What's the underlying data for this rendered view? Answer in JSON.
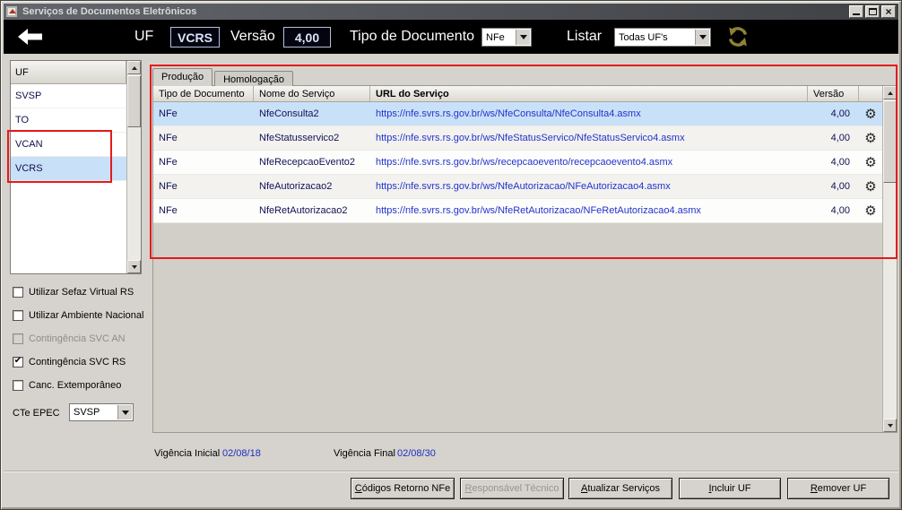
{
  "colors": {
    "annotation_red": "#e31b1b",
    "selected_row_blue": "#c9e1f8",
    "url_text_blue": "#2133cc",
    "toolbar_black": "#000000",
    "refresh_gold": "#8e8330",
    "window_gray": "#d6d3ce"
  },
  "icons": {
    "gear": "⚙",
    "check": "✔",
    "close": "×",
    "back_arrow": "left-arrow",
    "refresh": "circular-arrows",
    "dropdown": "triangle-down"
  },
  "window": {
    "title": "Serviços de Documentos Eletrônicos"
  },
  "toolbar": {
    "uf_label": "UF",
    "uf_value": "VCRS",
    "versao_label": "Versão",
    "versao_value": "4,00",
    "tipo_documento_label": "Tipo de Documento",
    "tipo_documento_value": "NFe",
    "listar_label": "Listar",
    "listar_value": "Todas UF's"
  },
  "sidebar": {
    "list": {
      "header": "UF",
      "items": [
        {
          "label": "SVSP",
          "selected": false
        },
        {
          "label": "TO",
          "selected": false
        },
        {
          "label": "VCAN",
          "selected": false
        },
        {
          "label": "VCRS",
          "selected": true
        }
      ]
    },
    "checkboxes": [
      {
        "label": "Utilizar Sefaz Virtual RS",
        "checked": false,
        "disabled": false
      },
      {
        "label": "Utilizar Ambiente Nacional",
        "checked": false,
        "disabled": false
      },
      {
        "label": "Contingência SVC AN",
        "checked": false,
        "disabled": true
      },
      {
        "label": "Contingência SVC RS",
        "checked": true,
        "disabled": false
      },
      {
        "label": "Canc. Extemporâneo",
        "checked": false,
        "disabled": false
      }
    ],
    "cte_epec": {
      "label": "CTe EPEC",
      "value": "SVSP"
    }
  },
  "main": {
    "tabs": [
      {
        "label": "Produção",
        "active": true
      },
      {
        "label": "Homologação",
        "active": false
      }
    ],
    "table": {
      "columns": [
        "Tipo de Documento",
        "Nome do Serviço",
        "URL do Serviço",
        "Versão"
      ],
      "selected_row_index": 0,
      "rows": [
        {
          "tipo": "NFe",
          "nome": "NfeConsulta2",
          "url": "https://nfe.svrs.rs.gov.br/ws/NfeConsulta/NfeConsulta4.asmx",
          "versao": "4,00"
        },
        {
          "tipo": "NFe",
          "nome": "NfeStatusservico2",
          "url": "https://nfe.svrs.rs.gov.br/ws/NfeStatusServico/NfeStatusServico4.asmx",
          "versao": "4,00"
        },
        {
          "tipo": "NFe",
          "nome": "NfeRecepcaoEvento2",
          "url": "https://nfe.svrs.rs.gov.br/ws/recepcaoevento/recepcaoevento4.asmx",
          "versao": "4,00"
        },
        {
          "tipo": "NFe",
          "nome": "NfeAutorizacao2",
          "url": "https://nfe.svrs.rs.gov.br/ws/NfeAutorizacao/NFeAutorizacao4.asmx",
          "versao": "4,00"
        },
        {
          "tipo": "NFe",
          "nome": "NfeRetAutorizacao2",
          "url": "https://nfe.svrs.rs.gov.br/ws/NfeRetAutorizacao/NFeRetAutorizacao4.asmx",
          "versao": "4,00"
        }
      ]
    },
    "vigencia": {
      "inicial_label": "Vigência Inicial",
      "inicial_value": "02/08/18",
      "final_label": "Vigência Final",
      "final_value": "02/08/30"
    }
  },
  "footer": {
    "buttons": [
      {
        "label": "Códigos Retorno NFe",
        "disabled": false
      },
      {
        "label": "Responsável Técnico",
        "disabled": true
      },
      {
        "label": "Atualizar Serviços",
        "disabled": false
      },
      {
        "label": "Incluir UF",
        "disabled": false
      },
      {
        "label": "Remover UF",
        "disabled": false
      }
    ]
  }
}
